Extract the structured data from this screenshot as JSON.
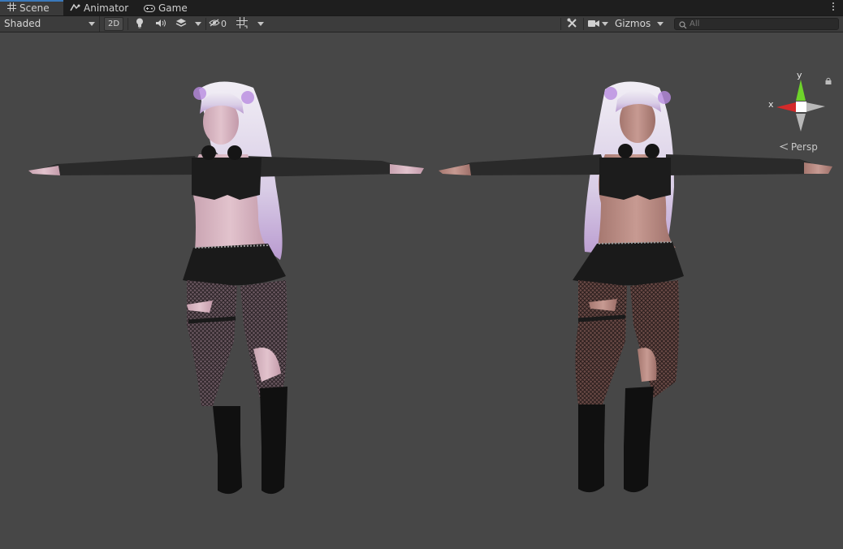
{
  "tabs": [
    {
      "label": "Scene",
      "icon": "grid-icon",
      "active": true
    },
    {
      "label": "Animator",
      "icon": "animator-icon",
      "active": false
    },
    {
      "label": "Game",
      "icon": "gamepad-icon",
      "active": false
    }
  ],
  "toolbar": {
    "draw_mode": "Shaded",
    "mode_2d": "2D",
    "hidden_count": "0",
    "gizmos_label": "Gizmos",
    "search_placeholder": "All"
  },
  "scene_gizmo": {
    "y_label": "y",
    "x_label": "x",
    "projection": "Persp"
  },
  "colors": {
    "background": "#474747",
    "tab_active_accent": "#3a79bb",
    "axis_x": "#d32a2a",
    "axis_y": "#6ed32a"
  }
}
